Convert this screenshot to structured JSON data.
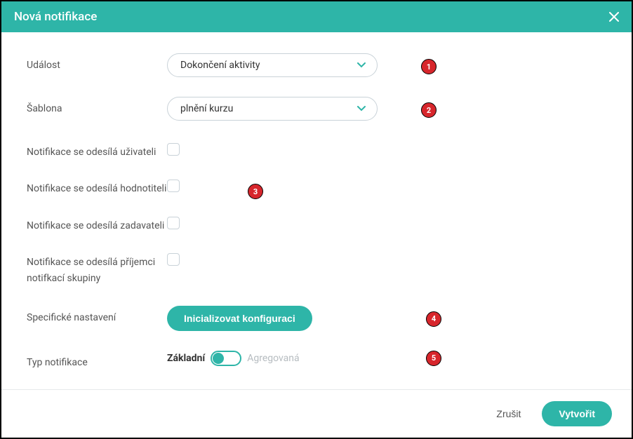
{
  "header": {
    "title": "Nová notifikace"
  },
  "form": {
    "event": {
      "label": "Událost",
      "value": "Dokončení aktivity"
    },
    "template": {
      "label": "Šablona",
      "value": "plnění kurzu"
    },
    "chk_user": {
      "label": "Notifikace se odesílá uživateli"
    },
    "chk_eval": {
      "label": "Notifikace se odesílá hodnotiteli"
    },
    "chk_assigner": {
      "label": "Notifikace se odesílá zadavateli"
    },
    "chk_group": {
      "label": "Notifikace se odesílá příjemci notifkací skupiny"
    },
    "specific": {
      "label": "Specifické nastavení",
      "button": "Inicializovat konfiguraci"
    },
    "type": {
      "label": "Typ notifikace",
      "option_basic": "Základní",
      "option_agg": "Agregovaná"
    }
  },
  "footer": {
    "cancel": "Zrušit",
    "create": "Vytvořit"
  },
  "badges": {
    "b1": "1",
    "b2": "2",
    "b3": "3",
    "b4": "4",
    "b5": "5"
  }
}
